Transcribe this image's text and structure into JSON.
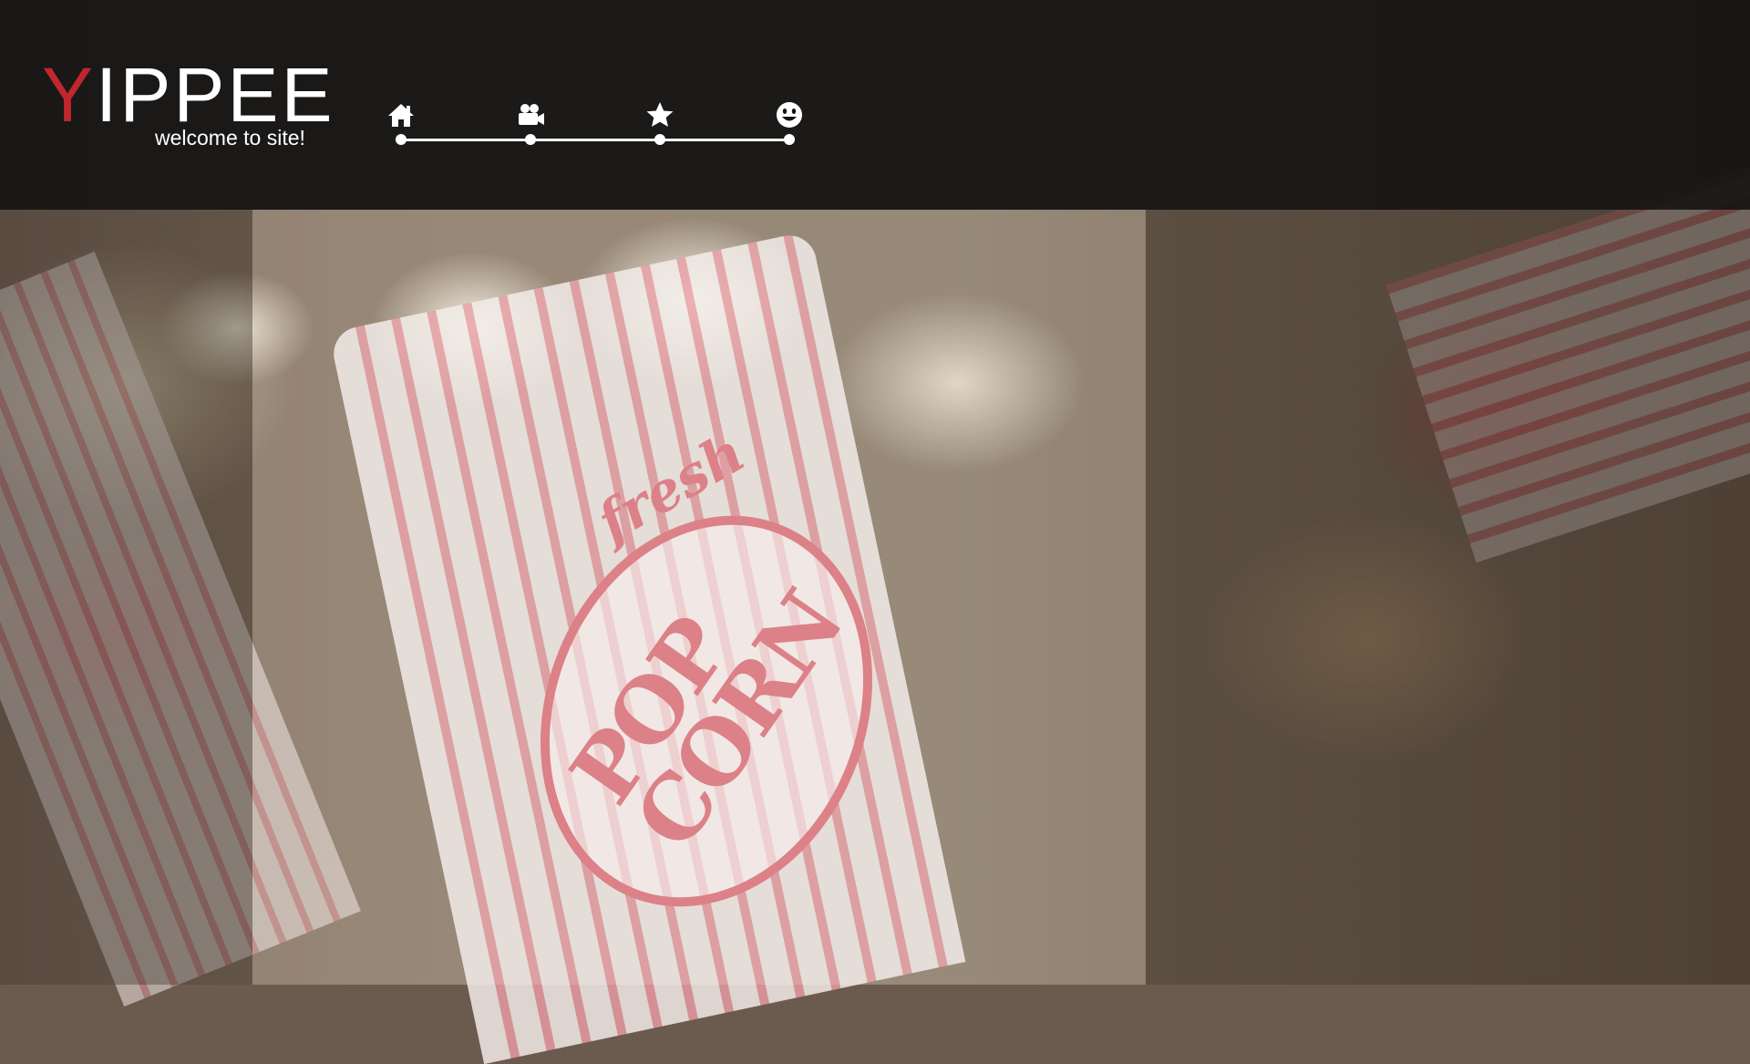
{
  "header": {
    "logo_first_letter": "Y",
    "logo_rest": "IPPEE",
    "tagline": "welcome to site!"
  },
  "nav": {
    "items": [
      {
        "icon": "home-icon"
      },
      {
        "icon": "video-camera-icon"
      },
      {
        "icon": "star-icon"
      },
      {
        "icon": "smiley-icon"
      }
    ]
  },
  "colors": {
    "brand_accent": "#c0272d",
    "header_bg": "#121212",
    "nav_foreground": "#ffffff"
  }
}
